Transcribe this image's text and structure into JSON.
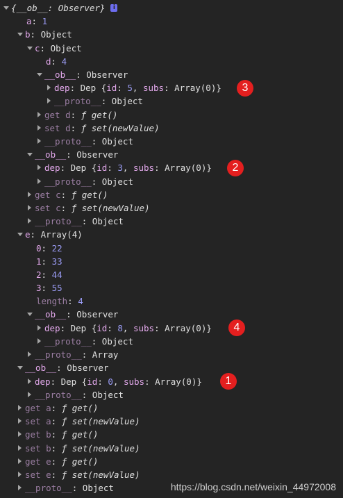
{
  "rows": [
    {
      "t": "root",
      "label": "{__ob__: Observer}"
    },
    {
      "t": "kv",
      "key": "a",
      "val": "1",
      "num": true
    },
    {
      "t": "kv",
      "key": "b",
      "val": "Object"
    },
    {
      "t": "kv",
      "key": "c",
      "val": "Object"
    },
    {
      "t": "kv",
      "key": "d",
      "val": "4",
      "num": true
    },
    {
      "t": "kv",
      "key": "__ob__",
      "val": "Observer"
    },
    {
      "t": "dep",
      "key": "dep",
      "id": "5",
      "subs": "Array(0)"
    },
    {
      "t": "kv",
      "key": "__proto__",
      "val": "Object"
    },
    {
      "t": "get",
      "key": "get d",
      "fn": "get()"
    },
    {
      "t": "get",
      "key": "set d",
      "fn": "set(newValue)"
    },
    {
      "t": "kv",
      "key": "__proto__",
      "val": "Object"
    },
    {
      "t": "kv",
      "key": "__ob__",
      "val": "Observer"
    },
    {
      "t": "dep",
      "key": "dep",
      "id": "3",
      "subs": "Array(0)"
    },
    {
      "t": "kv",
      "key": "__proto__",
      "val": "Object"
    },
    {
      "t": "get",
      "key": "get c",
      "fn": "get()"
    },
    {
      "t": "get",
      "key": "set c",
      "fn": "set(newValue)"
    },
    {
      "t": "kv",
      "key": "__proto__",
      "val": "Object"
    },
    {
      "t": "kv",
      "key": "e",
      "val": "Array(4)"
    },
    {
      "t": "kv",
      "key": "0",
      "val": "22",
      "num": true
    },
    {
      "t": "kv",
      "key": "1",
      "val": "33",
      "num": true
    },
    {
      "t": "kv",
      "key": "2",
      "val": "44",
      "num": true
    },
    {
      "t": "kv",
      "key": "3",
      "val": "55",
      "num": true
    },
    {
      "t": "kv",
      "key": "length",
      "val": "4",
      "num": true,
      "dim": true
    },
    {
      "t": "kv",
      "key": "__ob__",
      "val": "Observer"
    },
    {
      "t": "dep",
      "key": "dep",
      "id": "8",
      "subs": "Array(0)"
    },
    {
      "t": "kv",
      "key": "__proto__",
      "val": "Object"
    },
    {
      "t": "kv",
      "key": "__proto__",
      "val": "Array"
    },
    {
      "t": "kv",
      "key": "__ob__",
      "val": "Observer"
    },
    {
      "t": "dep",
      "key": "dep",
      "id": "0",
      "subs": "Array(0)"
    },
    {
      "t": "kv",
      "key": "__proto__",
      "val": "Object"
    },
    {
      "t": "get",
      "key": "get a",
      "fn": "get()"
    },
    {
      "t": "get",
      "key": "set a",
      "fn": "set(newValue)"
    },
    {
      "t": "get",
      "key": "get b",
      "fn": "get()"
    },
    {
      "t": "get",
      "key": "set b",
      "fn": "set(newValue)"
    },
    {
      "t": "get",
      "key": "get e",
      "fn": "get()"
    },
    {
      "t": "get",
      "key": "set e",
      "fn": "set(newValue)"
    },
    {
      "t": "kv",
      "key": "__proto__",
      "val": "Object"
    }
  ],
  "badges": [
    "3",
    "2",
    "4",
    "1"
  ],
  "watermark": "https://blog.csdn.net/weixin_44972008",
  "colors": {
    "badge": "#e41f1f",
    "background": "#242424",
    "key": "#e3a9ec",
    "number": "#9b9cf5"
  }
}
